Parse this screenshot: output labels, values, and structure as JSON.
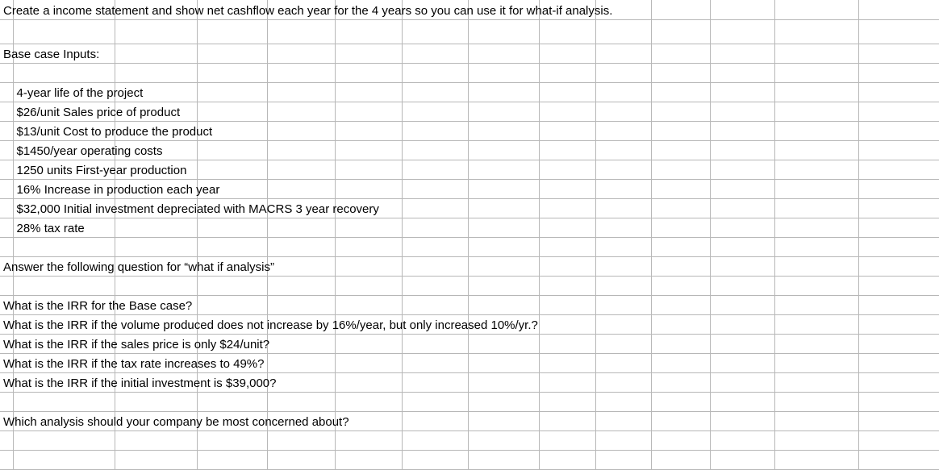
{
  "rows": [
    {
      "col": "A",
      "text": "Create a income statement and show net cashflow each year for the 4 years so you can use it for what-if analysis."
    },
    {
      "col": "A",
      "text": "",
      "tall": true
    },
    {
      "col": "A",
      "text": "Base case Inputs:"
    },
    {
      "col": "A",
      "text": ""
    },
    {
      "col": "B",
      "text": "4-year life of the project"
    },
    {
      "col": "B",
      "text": "$26/unit Sales price of product"
    },
    {
      "col": "B",
      "text": "$13/unit Cost to produce the product"
    },
    {
      "col": "B",
      "text": "$1450/year operating costs"
    },
    {
      "col": "B",
      "text": "1250 units First-year production"
    },
    {
      "col": "B",
      "text": "16% Increase in production each year"
    },
    {
      "col": "B",
      "text": "$32,000 Initial investment depreciated with MACRS 3 year recovery"
    },
    {
      "col": "B",
      "text": "28% tax rate"
    },
    {
      "col": "A",
      "text": ""
    },
    {
      "col": "A",
      "text": "Answer the following question for “what if analysis”"
    },
    {
      "col": "A",
      "text": ""
    },
    {
      "col": "A",
      "text": "What is the IRR for the Base case?"
    },
    {
      "col": "A",
      "text": "What is the IRR if the volume produced does not increase by 16%/year, but only increased 10%/yr.?"
    },
    {
      "col": "A",
      "text": "What is the IRR if the sales price is only $24/unit?"
    },
    {
      "col": "A",
      "text": "What is the IRR if the tax rate increases to 49%?"
    },
    {
      "col": "A",
      "text": "What is the IRR if the initial investment is $39,000?"
    },
    {
      "col": "A",
      "text": ""
    },
    {
      "col": "A",
      "text": "Which analysis should your company be most concerned about?"
    },
    {
      "col": "A",
      "text": ""
    },
    {
      "col": "A",
      "text": ""
    }
  ],
  "columns": [
    "A",
    "B",
    "C",
    "D",
    "E",
    "F",
    "G",
    "H",
    "I",
    "J",
    "K",
    "L",
    "M",
    "N"
  ]
}
